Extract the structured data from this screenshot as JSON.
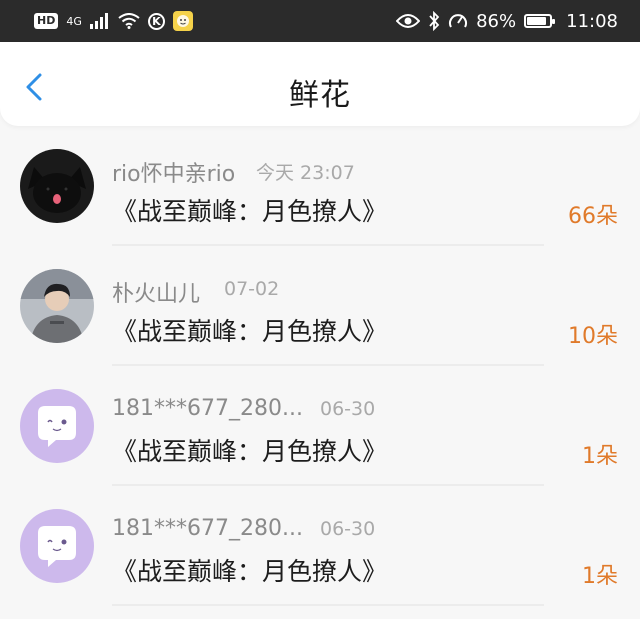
{
  "status_bar": {
    "hd": "HD",
    "network": "4G",
    "k_badge": "K",
    "battery": "86%",
    "battery_level": 0.86,
    "time": "11:08",
    "icons": [
      "hd-icon",
      "signal-icon",
      "wifi-icon",
      "k-icon",
      "app-notification-icon",
      "eye-icon",
      "bluetooth-icon",
      "speedometer-icon",
      "battery-icon"
    ]
  },
  "header": {
    "title": "鲜花",
    "back_icon": "chevron-left-icon"
  },
  "colors": {
    "accent_blue": "#2f8fe6",
    "count_orange": "#e07a2a",
    "default_avatar_purple": "#cdb9ec"
  },
  "records": [
    {
      "name": "rio怀中亲rio",
      "date": "今天 23:07",
      "book": "《战至巅峰：月色撩人》",
      "count": "66朵",
      "avatar": "black-cat-avatar"
    },
    {
      "name": "朴火山儿",
      "date": "07-02",
      "book": "《战至巅峰：月色撩人》",
      "count": "10朵",
      "avatar": "person-photo-avatar"
    },
    {
      "name": "181***677_280...",
      "date": "06-30",
      "book": "《战至巅峰：月色撩人》",
      "count": "1朵",
      "avatar": "default-chat-bubble-avatar"
    },
    {
      "name": "181***677_280...",
      "date": "06-30",
      "book": "《战至巅峰：月色撩人》",
      "count": "1朵",
      "avatar": "default-chat-bubble-avatar"
    }
  ]
}
